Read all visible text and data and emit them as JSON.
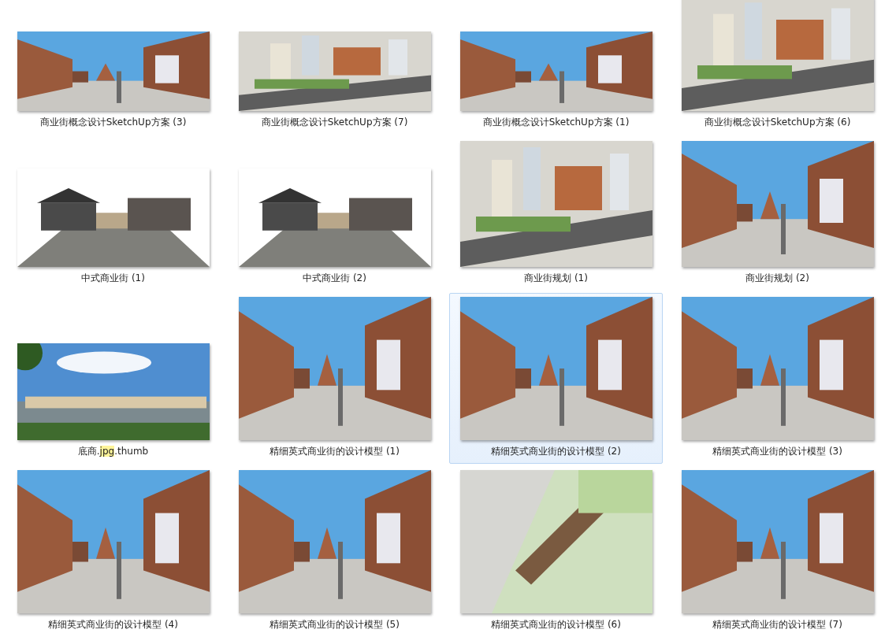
{
  "items": [
    {
      "label": "商业街概念设计SketchUp方案 (3)",
      "selected": false
    },
    {
      "label": "商业街概念设计SketchUp方案 (7)",
      "selected": false
    },
    {
      "label": "商业街概念设计SketchUp方案 (1)",
      "selected": false
    },
    {
      "label": "商业街概念设计SketchUp方案 (6)",
      "selected": false
    },
    {
      "label": "中式商业街 (1)",
      "selected": false
    },
    {
      "label": "中式商业街 (2)",
      "selected": false
    },
    {
      "label": "商业街规划 (1)",
      "selected": false
    },
    {
      "label": "商业街规划 (2)",
      "selected": false
    },
    {
      "label_parts": [
        {
          "text": "底商.",
          "highlighted": false
        },
        {
          "text": "jpg",
          "highlighted": true
        },
        {
          "text": ".thumb",
          "highlighted": false
        }
      ],
      "selected": false
    },
    {
      "label": "精细英式商业街的设计模型 (1)",
      "selected": false
    },
    {
      "label": "精细英式商业街的设计模型 (2)",
      "selected": true
    },
    {
      "label": "精细英式商业街的设计模型 (3)",
      "selected": false
    },
    {
      "label": "精细英式商业街的设计模型 (4)",
      "selected": false
    },
    {
      "label": "精细英式商业街的设计模型 (5)",
      "selected": false
    },
    {
      "label": "精细英式商业街的设计模型 (6)",
      "selected": false
    },
    {
      "label": "精细英式商业街的设计模型 (7)",
      "selected": false
    }
  ]
}
